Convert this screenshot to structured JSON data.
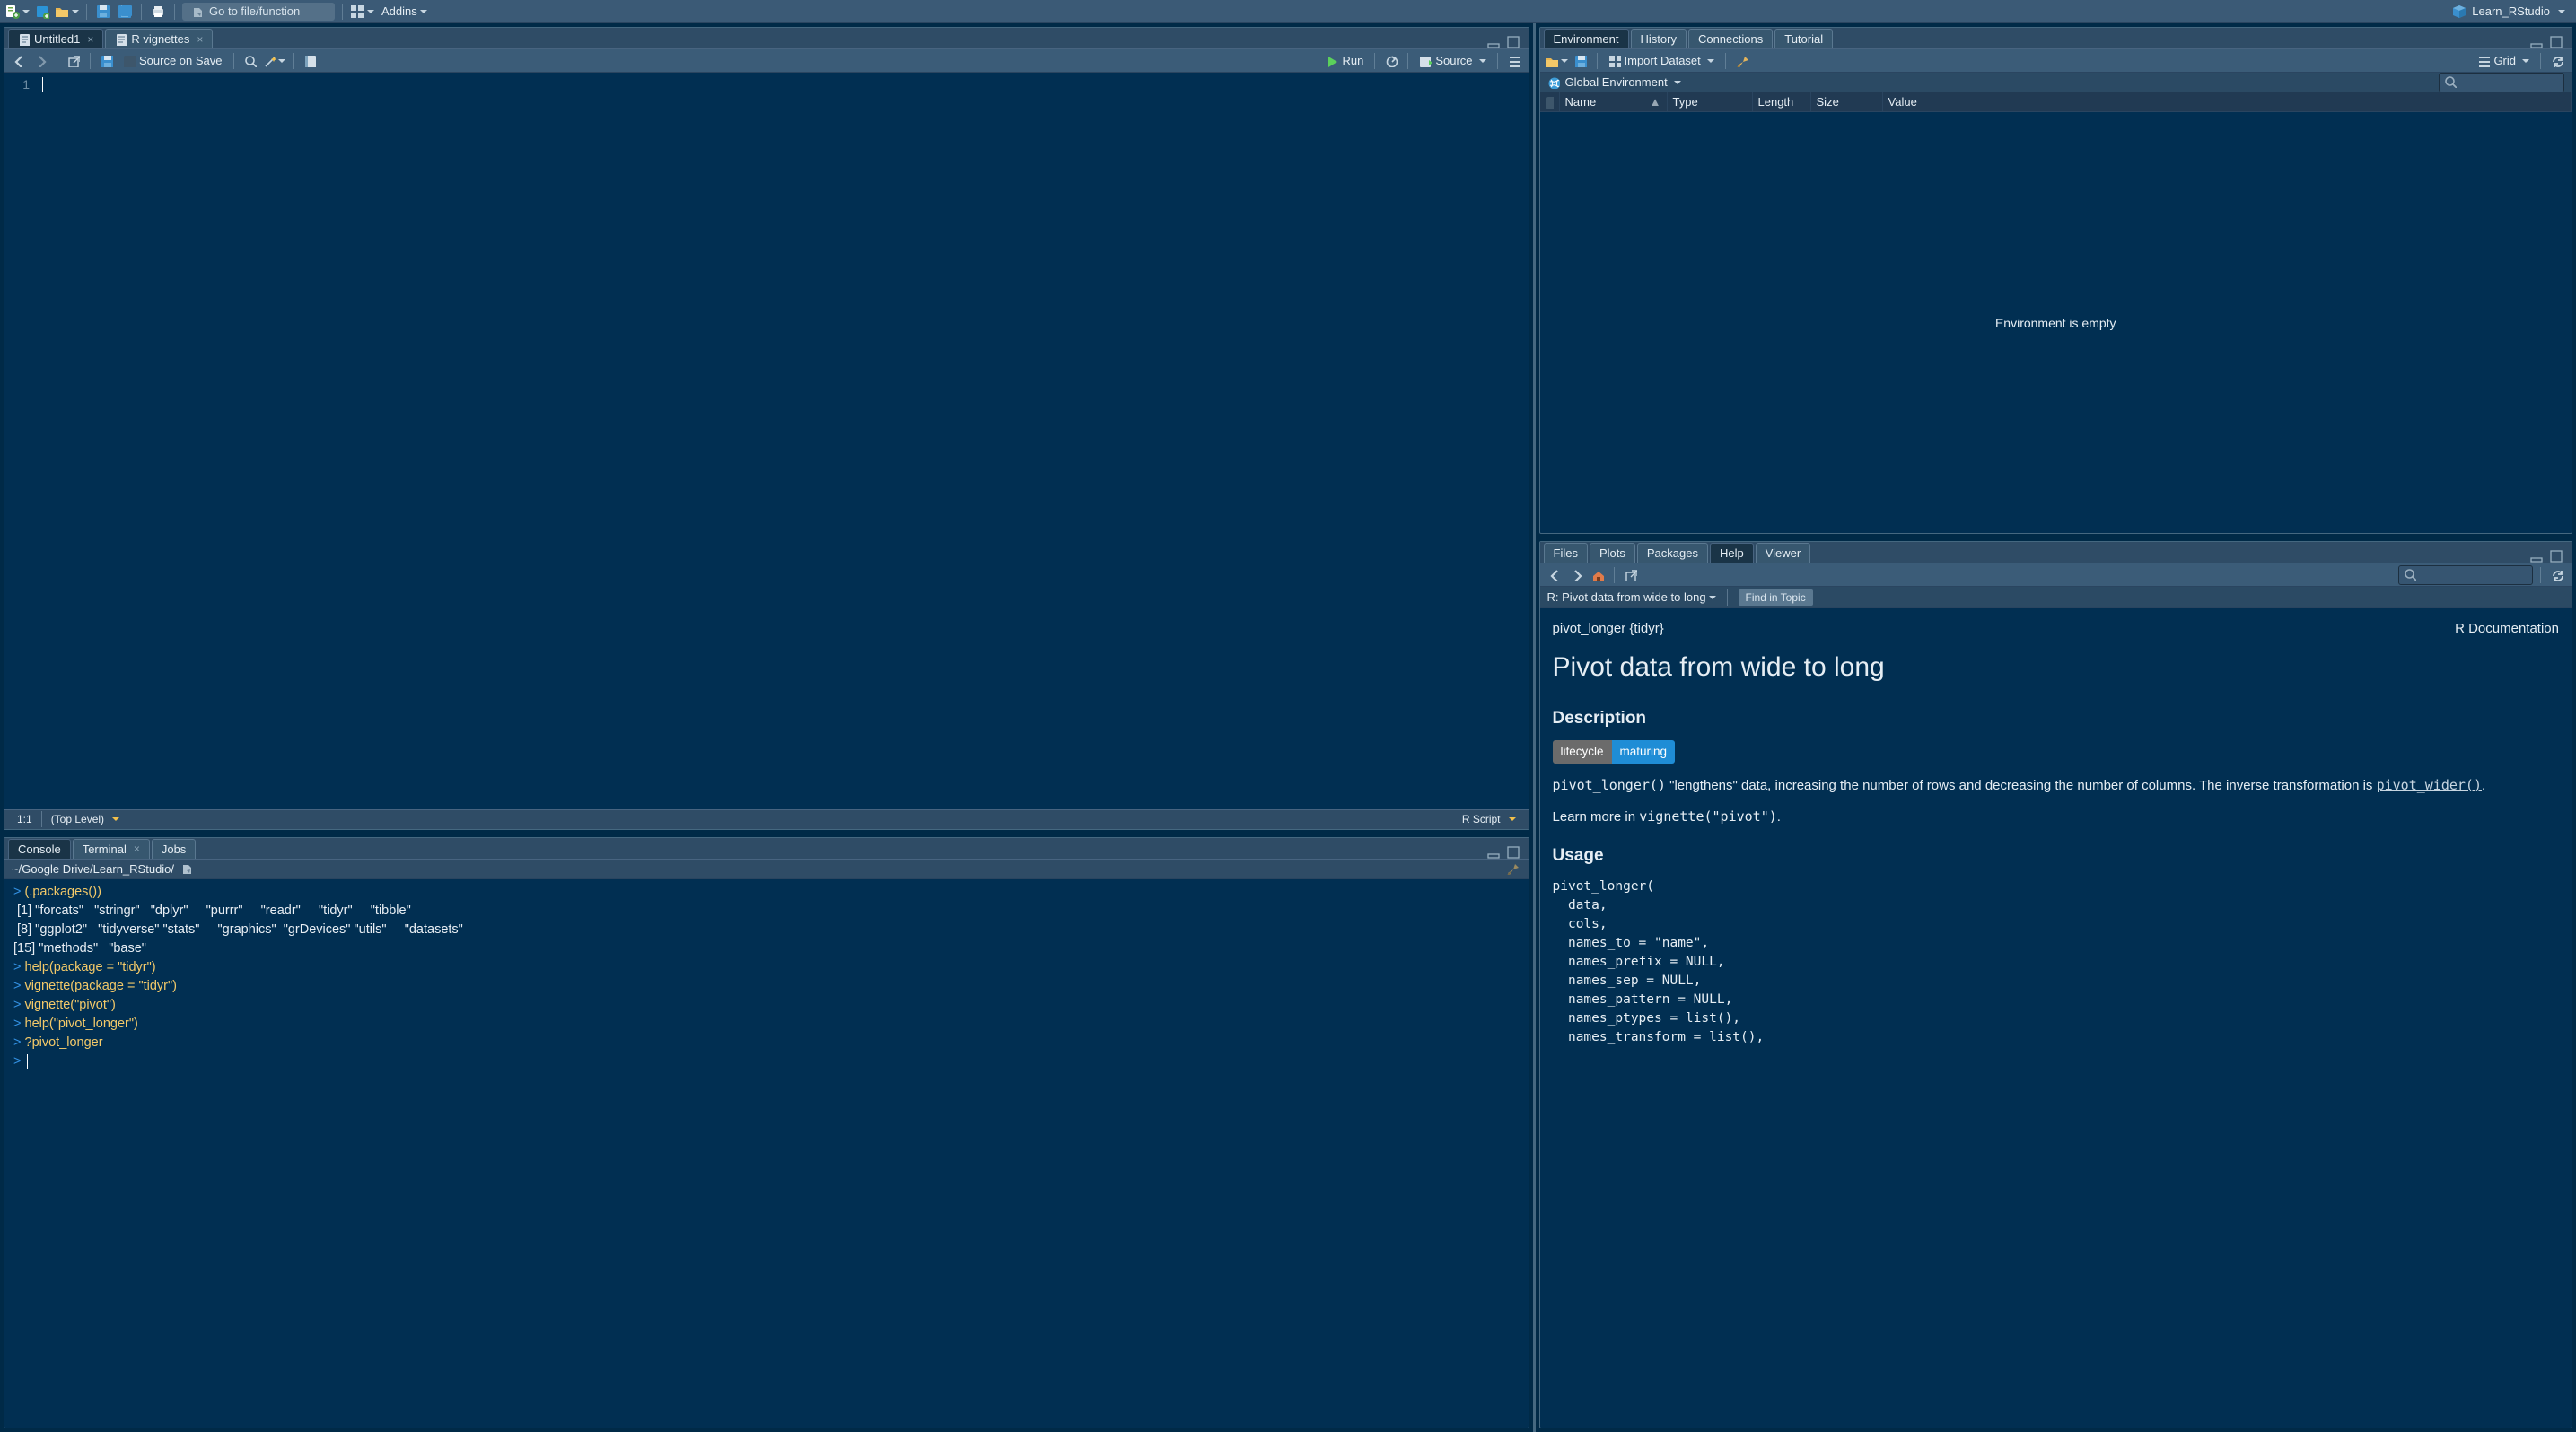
{
  "app_toolbar": {
    "goto_placeholder": "Go to file/function",
    "addins_label": "Addins",
    "project_name": "Learn_RStudio"
  },
  "source": {
    "tabs": [
      {
        "label": "Untitled1",
        "closeable": true,
        "icon": "rscript",
        "active": true
      },
      {
        "label": "R vignettes",
        "closeable": true,
        "icon": "doc",
        "active": false
      }
    ],
    "toolbar": {
      "source_on_save": "Source on Save",
      "run_label": "Run",
      "source_label": "Source"
    },
    "gutter_first_line": "1",
    "status": {
      "pos": "1:1",
      "scope": "(Top Level)",
      "lang": "R Script"
    }
  },
  "console": {
    "tabs": [
      {
        "label": "Console",
        "active": true
      },
      {
        "label": "Terminal",
        "closeable": true
      },
      {
        "label": "Jobs"
      }
    ],
    "path": "~/Google Drive/Learn_RStudio/",
    "lines": [
      {
        "t": "cmd",
        "prompt": "> ",
        "text": "(.packages())"
      },
      {
        "t": "out",
        "text": " [1] \"forcats\"   \"stringr\"   \"dplyr\"     \"purrr\"     \"readr\"     \"tidyr\"     \"tibble\"   "
      },
      {
        "t": "out",
        "text": " [8] \"ggplot2\"   \"tidyverse\" \"stats\"     \"graphics\"  \"grDevices\" \"utils\"     \"datasets\" "
      },
      {
        "t": "out",
        "text": "[15] \"methods\"   \"base\"     "
      },
      {
        "t": "cmd",
        "prompt": "> ",
        "text": "help(package = \"tidyr\")"
      },
      {
        "t": "cmd",
        "prompt": "> ",
        "text": "vignette(package = \"tidyr\")"
      },
      {
        "t": "cmd",
        "prompt": "> ",
        "text": "vignette(\"pivot\")"
      },
      {
        "t": "cmd",
        "prompt": "> ",
        "text": "help(\"pivot_longer\")"
      },
      {
        "t": "cmd",
        "prompt": "> ",
        "text": "?pivot_longer"
      },
      {
        "t": "cmd",
        "prompt": "> ",
        "text": ""
      }
    ]
  },
  "environment": {
    "tabs": [
      {
        "label": "Environment",
        "active": true
      },
      {
        "label": "History"
      },
      {
        "label": "Connections"
      },
      {
        "label": "Tutorial"
      }
    ],
    "toolbar": {
      "import_label": "Import Dataset",
      "view_label": "Grid"
    },
    "scope_label": "Global Environment",
    "columns": [
      "Name",
      "Type",
      "Length",
      "Size",
      "Value"
    ],
    "empty_text": "Environment is empty"
  },
  "help": {
    "tabs": [
      {
        "label": "Files"
      },
      {
        "label": "Plots"
      },
      {
        "label": "Packages"
      },
      {
        "label": "Help",
        "active": true
      },
      {
        "label": "Viewer"
      }
    ],
    "crumb": "R: Pivot data from wide to long",
    "find_placeholder": "Find in Topic",
    "topline": {
      "pkg": "pivot_longer {tidyr}",
      "doc": "R Documentation"
    },
    "title": "Pivot data from wide to long",
    "section_description": "Description",
    "badge_left": "lifecycle",
    "badge_right": "maturing",
    "desc_fn": "pivot_longer()",
    "desc_text_1": " \"lengthens\" data, increasing the number of rows and decreasing the number of columns. The inverse transformation is ",
    "desc_link": "pivot_wider()",
    "learn_more_prefix": "Learn more in ",
    "learn_more_code": "vignette(\"pivot\")",
    "learn_more_suffix": ".",
    "section_usage": "Usage",
    "usage": "pivot_longer(\n  data,\n  cols,\n  names_to = \"name\",\n  names_prefix = NULL,\n  names_sep = NULL,\n  names_pattern = NULL,\n  names_ptypes = list(),\n  names_transform = list(),"
  }
}
